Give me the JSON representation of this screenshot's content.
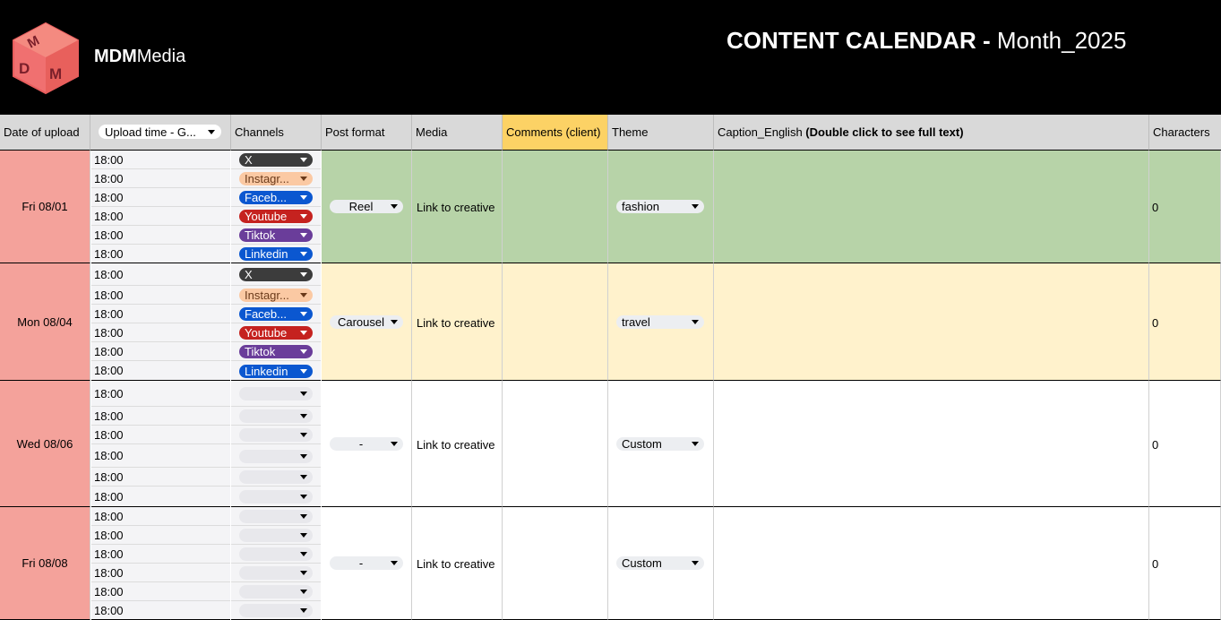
{
  "header": {
    "brand_bold": "MDM",
    "brand_rest": "Media",
    "title_bold": "CONTENT CALENDAR -",
    "title_rest": " Month_2025",
    "logo_icon": "mdm-cube-logo-icon"
  },
  "columns": {
    "date": "Date of upload",
    "upload_time": "Upload time - G...",
    "channels": "Channels",
    "post_format": "Post format",
    "media": "Media",
    "comments": "Comments (client)",
    "theme": "Theme",
    "caption_plain": "Caption_English ",
    "caption_bold": "(Double click to see full text)",
    "characters": "Characters"
  },
  "colors": {
    "date_bg": "#f4a29b",
    "row1_bg": "#b7d3a8",
    "row2_bg": "#fff2cc",
    "comments_header": "#fcd265",
    "X": "#3c3c3c",
    "Instagram": "#fbc9a3",
    "Facebook": "#0b57d0",
    "Youtube": "#c5221f",
    "Tiktok": "#6a3d9a",
    "Linkedin": "#0b57d0"
  },
  "posts": [
    {
      "date": "Fri 08/01",
      "times": [
        "18:00",
        "18:00",
        "18:00",
        "18:00",
        "18:00",
        "18:00"
      ],
      "channels": [
        "X",
        "Instagr...",
        "Faceb...",
        "Youtube",
        "Tiktok",
        "Linkedin"
      ],
      "post_format": "Reel",
      "media": "Link to creative",
      "comments": "",
      "theme": "fashion",
      "caption": "",
      "characters": "0"
    },
    {
      "date": "Mon 08/04",
      "times": [
        "18:00",
        "18:00",
        "18:00",
        "18:00",
        "18:00",
        "18:00"
      ],
      "channels": [
        "X",
        "Instagr...",
        "Faceb...",
        "Youtube",
        "Tiktok",
        "Linkedin"
      ],
      "post_format": "Carousel",
      "media": "Link to creative",
      "comments": "",
      "theme": "travel",
      "caption": "",
      "characters": "0"
    },
    {
      "date": "Wed 08/06",
      "times": [
        "18:00",
        "18:00",
        "18:00",
        "18:00",
        "18:00",
        "18:00"
      ],
      "channels": [
        "",
        "",
        "",
        "",
        "",
        ""
      ],
      "post_format": "-",
      "media": "Link to creative",
      "comments": "",
      "theme": "Custom",
      "caption": "",
      "characters": "0"
    },
    {
      "date": "Fri 08/08",
      "times": [
        "18:00",
        "18:00",
        "18:00",
        "18:00",
        "18:00",
        "18:00"
      ],
      "channels": [
        "",
        "",
        "",
        "",
        "",
        ""
      ],
      "post_format": "-",
      "media": "Link to creative",
      "comments": "",
      "theme": "Custom",
      "caption": "",
      "characters": "0"
    }
  ]
}
